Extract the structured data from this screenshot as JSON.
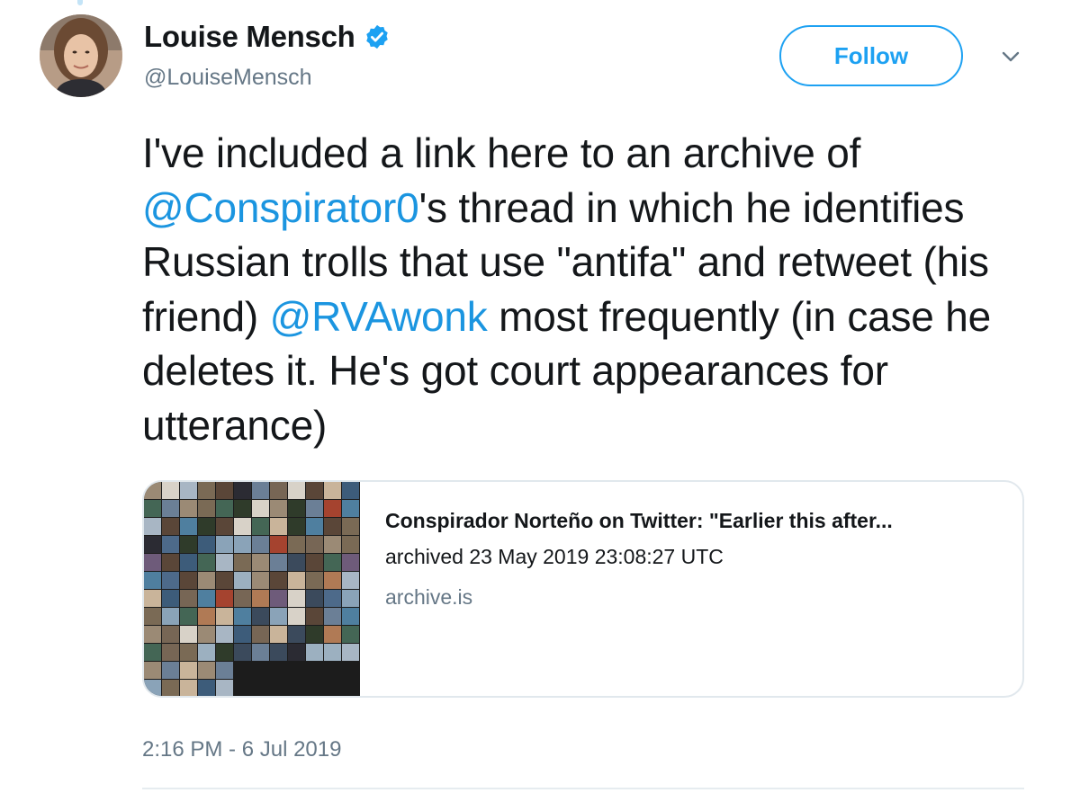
{
  "author": {
    "name": "Louise Mensch",
    "handle": "@LouiseMensch",
    "verified_icon": "verified-badge-icon",
    "avatar": "profile-photo"
  },
  "actions": {
    "follow_label": "Follow",
    "more_icon": "chevron-down-icon"
  },
  "tweet": {
    "segments": [
      {
        "text": "I've included a link here to an archive of ",
        "type": "text"
      },
      {
        "text": "@Conspirator0",
        "type": "mention"
      },
      {
        "text": "'s thread in which he identifies Russian trolls that use \"antifa\" and retweet (his friend) ",
        "type": "text"
      },
      {
        "text": "@RVAwonk",
        "type": "mention"
      },
      {
        "text": " most frequently (in case he deletes it. He's got court appearances for utterance)",
        "type": "text"
      }
    ]
  },
  "card": {
    "title": "Conspirador Norteño on Twitter: \"Earlier this after...",
    "description": "archived 23 May 2019 23:08:27 UTC",
    "domain": "archive.is",
    "thumbnail": "avatar-grid-image"
  },
  "timestamp": "2:16 PM - 6 Jul 2019",
  "colors": {
    "accent": "#1da1f2",
    "mention": "#1b95e0",
    "secondary_text": "#657786",
    "text": "#14171a",
    "border": "#e1e8ed"
  }
}
